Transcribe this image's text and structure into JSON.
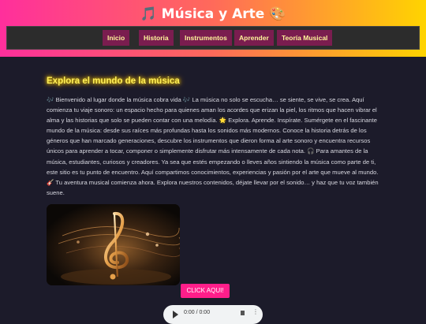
{
  "header": {
    "title": "🎵 Música y Arte 🎨",
    "gradient": [
      "#ff2f9c",
      "#ff6a5a",
      "#ffd400"
    ]
  },
  "nav": {
    "items": [
      {
        "label": "Inicio"
      },
      {
        "label": "Historia"
      },
      {
        "label": "Instrumentos"
      },
      {
        "label": "Aprender"
      },
      {
        "label": "Teoría Musical"
      }
    ],
    "item_color": "#7a1d4f",
    "text_color": "#fff59a"
  },
  "main": {
    "title": "Explora el mundo de la música",
    "intro": "🎶 Bienvenido al lugar donde la música cobra vida 🎶 La música no solo se escucha… se siente, se vive, se crea. Aquí comienza tu viaje sonoro: un espacio hecho para quienes aman los acordes que erizan la piel, los ritmos que hacen vibrar el alma y las historias que solo se pueden contar con una melodía. 🌟 Explora. Aprende. Inspírate. Sumérgete en el fascinante mundo de la música: desde sus raíces más profundas hasta los sonidos más modernos. Conoce la historia detrás de los géneros que han marcado generaciones, descubre los instrumentos que dieron forma al arte sonoro y encuentra recursos únicos para aprender a tocar, componer o simplemente disfrutar más intensamente de cada nota. 🎧 Para amantes de la música, estudiantes, curiosos y creadores. Ya sea que estés empezando o lleves años sintiendo la música como parte de ti, este sitio es tu punto de encuentro. Aquí compartimos conocimientos, experiencias y pasión por el arte que mueve al mundo. 🎸 Tu aventura musical comienza ahora. Explora nuestros contenidos, déjate llevar por el sonido… y haz que tu voz también suene.",
    "cta_label": "CLICK AQUI!",
    "cta_color": "#ff1e8a"
  },
  "audio": {
    "time": "0:00 / 0:00"
  },
  "icons": [
    "treble-clef-image",
    "play-icon",
    "volume-icon",
    "more-options-icon"
  ]
}
